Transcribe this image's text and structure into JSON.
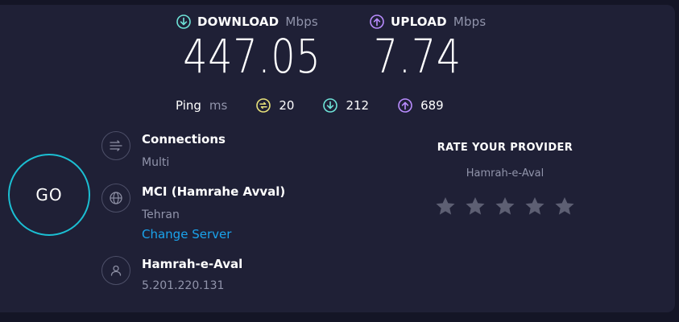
{
  "download": {
    "label": "DOWNLOAD",
    "unit": "Mbps",
    "value": "447.05",
    "icon": "download-arrow-icon",
    "color": "#6ee3d8"
  },
  "upload": {
    "label": "UPLOAD",
    "unit": "Mbps",
    "value": "7.74",
    "icon": "upload-arrow-icon",
    "color": "#b98cff"
  },
  "ping": {
    "label": "Ping",
    "unit": "ms",
    "idle": {
      "value": "20",
      "icon": "ping-icon",
      "color": "#e8e27a"
    },
    "down": {
      "value": "212",
      "icon": "download-arrow-icon",
      "color": "#6ee3d8"
    },
    "up": {
      "value": "689",
      "icon": "upload-arrow-icon",
      "color": "#b98cff"
    }
  },
  "go_button": {
    "label": "GO",
    "color": "#1bbfd3"
  },
  "connections": {
    "title": "Connections",
    "value": "Multi",
    "icon": "connections-icon"
  },
  "server": {
    "name": "MCI (Hamrahe Avval)",
    "location": "Tehran",
    "change_label": "Change Server",
    "icon": "globe-icon",
    "link_color": "#1aa3ec"
  },
  "isp": {
    "name": "Hamrah-e-Aval",
    "ip": "5.201.220.131",
    "icon": "user-icon"
  },
  "rating": {
    "title": "RATE YOUR PROVIDER",
    "provider": "Hamrah-e-Aval",
    "stars": 5,
    "star_color": "#5d5f73",
    "rating_value": 0
  }
}
